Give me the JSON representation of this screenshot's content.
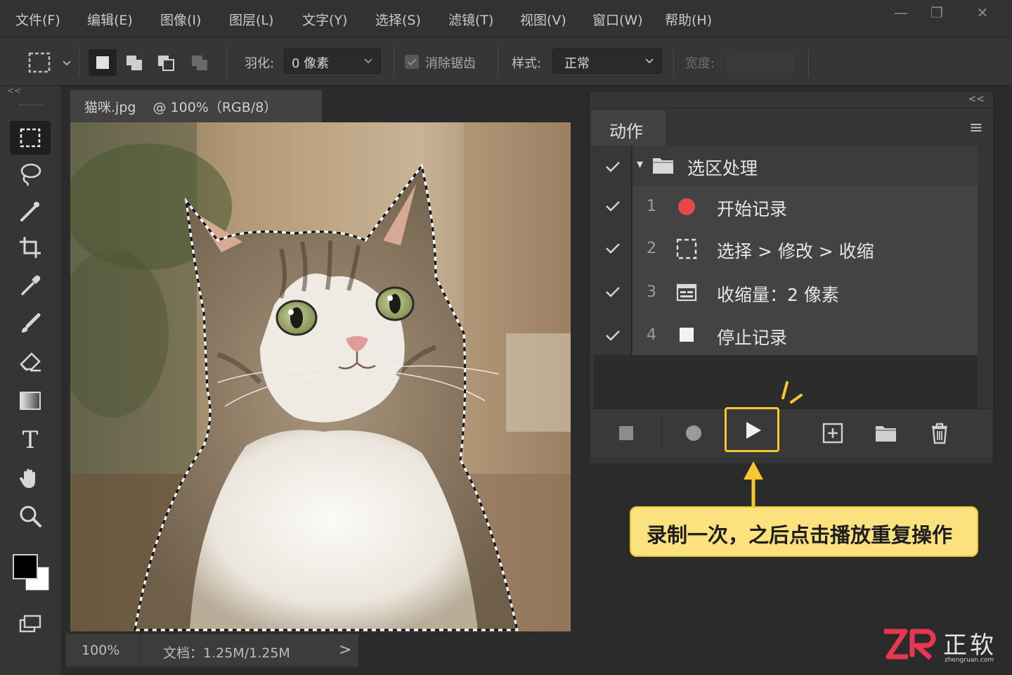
{
  "menu": [
    "文件(F)",
    "编辑(E)",
    "图像(I)",
    "图层(L)",
    "文字(Y)",
    "选择(S)",
    "滤镜(T)",
    "视图(V)",
    "窗口(W)",
    "帮助(H)"
  ],
  "window_controls": {
    "minimize": "—",
    "restore": "❐",
    "close": "✕"
  },
  "options": {
    "feather_label": "羽化:",
    "feather_value": "0 像素",
    "antialias_label": "消除锯齿",
    "antialias_checked": true,
    "style_label": "样式:",
    "style_value": "正常",
    "width_label": "宽度:"
  },
  "collapse_glyph": "<<",
  "document": {
    "tab_name": "猫咪.jpg",
    "tab_info": "@ 100%（RGB/8）",
    "zoom": "100%",
    "doc_info": "文档：1.25M/1.25M",
    "arrow": ">"
  },
  "tools": [
    "rectangular-marquee",
    "lasso",
    "quick-selection",
    "crop",
    "eyedropper",
    "brush",
    "eraser",
    "gradient",
    "type",
    "hand",
    "zoom"
  ],
  "type_tool_glyph": "T",
  "actions_panel": {
    "tab_label": "动作",
    "collapse_glyph": "<<",
    "menu_glyph": "≡",
    "set": {
      "expand_glyph": "▾",
      "name": "选区处理"
    },
    "steps": [
      {
        "num": "1",
        "label": "开始记录",
        "icon": "record-dot-icon"
      },
      {
        "num": "2",
        "label": "选择 > 修改 > 收缩",
        "icon": "marquee-icon"
      },
      {
        "num": "3",
        "label": "收缩量：2 像素",
        "icon": "dialog-icon"
      },
      {
        "num": "4",
        "label": "停止记录",
        "icon": "stop-square-icon"
      }
    ],
    "footer_buttons": [
      "stop",
      "record",
      "play",
      "new-action",
      "new-set",
      "delete"
    ]
  },
  "callout_text": "录制一次，之后点击播放重复操作",
  "watermark": {
    "mark": "ZR",
    "name": "正软",
    "site": "zhengruan.com"
  },
  "colors": {
    "accent_yellow": "#f6c72f",
    "callout_bg": "#fbe27e",
    "record_red": "#e84848",
    "logo_red": "#e8384f"
  }
}
